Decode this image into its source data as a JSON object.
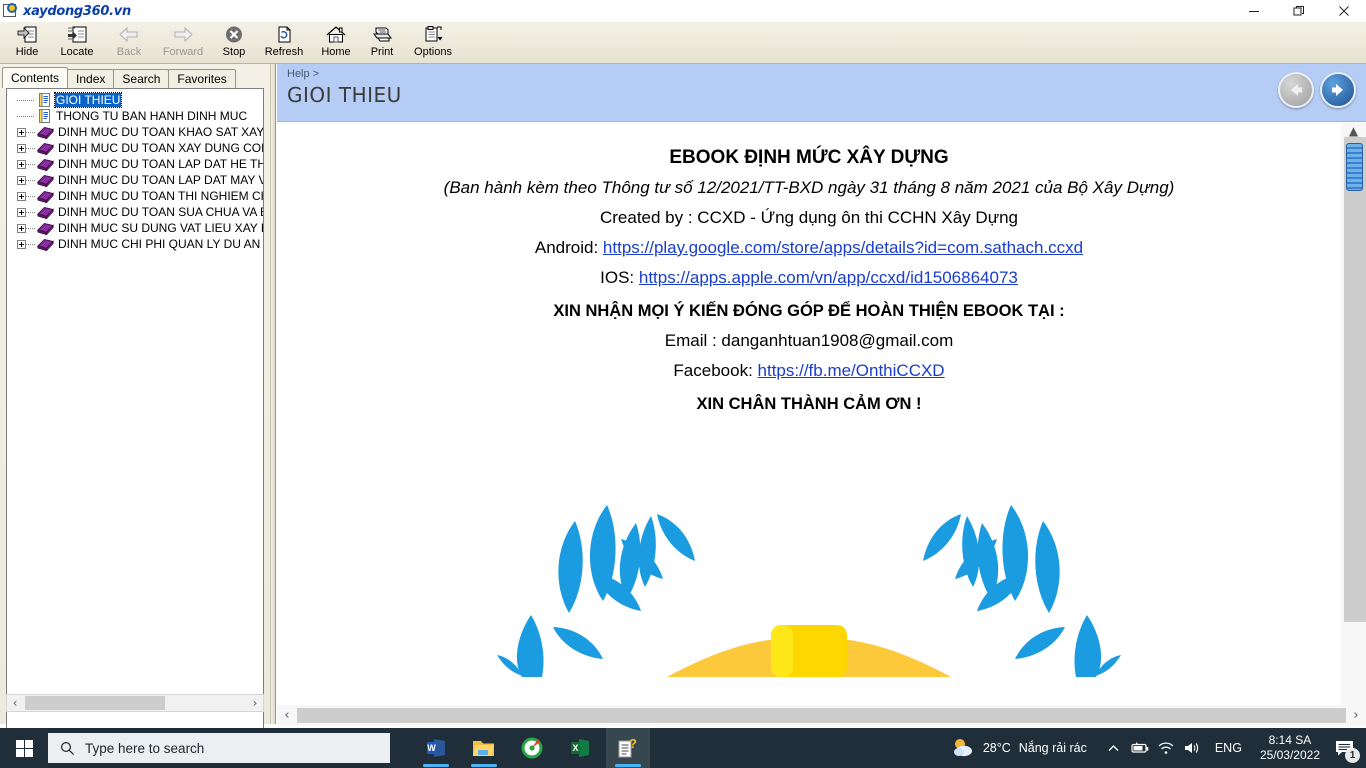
{
  "window": {
    "title": "xaydong360.vn",
    "app_icon": "help-viewer-icon",
    "minimize_label": "Minimize",
    "maximize_label": "Restore",
    "close_label": "Close"
  },
  "toolbar": {
    "buttons": [
      {
        "label": "Hide",
        "icon": "hide-panel-icon",
        "disabled": false
      },
      {
        "label": "Locate",
        "icon": "locate-icon",
        "disabled": false
      },
      {
        "label": "Back",
        "icon": "arrow-left-icon",
        "disabled": true
      },
      {
        "label": "Forward",
        "icon": "arrow-right-icon",
        "disabled": true
      },
      {
        "label": "Stop",
        "icon": "stop-icon",
        "disabled": false
      },
      {
        "label": "Refresh",
        "icon": "refresh-icon",
        "disabled": false
      },
      {
        "label": "Home",
        "icon": "home-icon",
        "disabled": false
      },
      {
        "label": "Print",
        "icon": "printer-icon",
        "disabled": false
      },
      {
        "label": "Options",
        "icon": "options-icon",
        "disabled": false
      }
    ]
  },
  "sidebar": {
    "tabs": [
      {
        "label": "Contents",
        "active": true
      },
      {
        "label": "Index",
        "active": false
      },
      {
        "label": "Search",
        "active": false
      },
      {
        "label": "Favorites",
        "active": false
      }
    ],
    "tree": [
      {
        "label": "GIOI THIEU",
        "icon": "page-icon",
        "expandable": false,
        "selected": true
      },
      {
        "label": "THONG TU BAN HANH DINH MUC",
        "icon": "page-icon",
        "expandable": false,
        "selected": false
      },
      {
        "label": "DINH MUC DU TOAN KHAO SAT XAY DUNG",
        "icon": "book-icon",
        "expandable": true,
        "selected": false
      },
      {
        "label": "DINH MUC DU TOAN XAY DUNG CONG TRINH",
        "icon": "book-icon",
        "expandable": true,
        "selected": false
      },
      {
        "label": "DINH MUC DU TOAN LAP DAT HE THONG KY THUAT",
        "icon": "book-icon",
        "expandable": true,
        "selected": false
      },
      {
        "label": "DINH MUC DU TOAN LAP DAT MAY VA THIET BI",
        "icon": "book-icon",
        "expandable": true,
        "selected": false
      },
      {
        "label": "DINH MUC DU TOAN THI NGHIEM CHUYEN NGANH",
        "icon": "book-icon",
        "expandable": true,
        "selected": false
      },
      {
        "label": "DINH MUC DU TOAN SUA CHUA VA BAO DUONG",
        "icon": "book-icon",
        "expandable": true,
        "selected": false
      },
      {
        "label": "DINH MUC SU DUNG VAT LIEU XAY DUNG",
        "icon": "book-icon",
        "expandable": true,
        "selected": false
      },
      {
        "label": "DINH MUC CHI PHI QUAN LY DU AN VA TU VAN",
        "icon": "book-icon",
        "expandable": true,
        "selected": false
      }
    ],
    "hscroll_left": "‹",
    "hscroll_right": "›"
  },
  "topic": {
    "breadcrumb": "Help >",
    "title": "GIOI THIEU",
    "nav_back": "back-arrow-button",
    "nav_forward": "forward-arrow-button",
    "header_color": "#b5ccf5"
  },
  "content": {
    "lines": [
      {
        "text": "EBOOK ĐỊNH MỨC XÂY DỰNG",
        "style": "bold"
      },
      {
        "text": "(Ban hành kèm theo Thông tư số 12/2021/TT-BXD ngày 31 tháng 8 năm 2021 của Bộ Xây Dựng)",
        "style": "italic"
      },
      {
        "text": "Created by : CCXD - Ứng dụng ôn thi CCHN Xây Dựng",
        "style": "normal"
      },
      {
        "text": "Android: ",
        "style": "normal",
        "link": "https://play.google.com/store/apps/details?id=com.sathach.ccxd"
      },
      {
        "text": "IOS: ",
        "style": "normal",
        "link": "https://apps.apple.com/vn/app/ccxd/id1506864073"
      },
      {
        "text": "XIN NHẬN MỌI Ý KIẾN ĐÓNG GÓP ĐỂ HOÀN THIỆN EBOOK TẠI :",
        "style": "bold-small"
      },
      {
        "text": "Email : danganhtuan1908@gmail.com",
        "style": "normal"
      },
      {
        "text": "Facebook: ",
        "style": "normal",
        "link": "https://fb.me/OnthiCCXD"
      },
      {
        "text": "XIN CHÂN THÀNH CẢM ƠN !",
        "style": "bold-small"
      }
    ],
    "graphic": {
      "name": "laurel-wreath-trophy",
      "leaf_color": "#1b9ce0",
      "trophy_color": "#ffd700",
      "trophy_shade": "#fcc93a"
    }
  },
  "taskbar": {
    "start_label": "Start",
    "search_placeholder": "Type here to search",
    "apps": [
      {
        "name": "word-taskbar-icon",
        "label": "W",
        "active": false,
        "running": true
      },
      {
        "name": "file-explorer-taskbar-icon",
        "label": "",
        "active": false,
        "running": true
      },
      {
        "name": "disc-app-taskbar-icon",
        "label": "",
        "active": false,
        "running": false
      },
      {
        "name": "excel-taskbar-icon",
        "label": "X",
        "active": false,
        "running": false
      },
      {
        "name": "help-viewer-taskbar-icon",
        "label": "",
        "active": true,
        "running": true
      }
    ],
    "tray": {
      "temperature": "28°C",
      "weather_text": "Nắng rải rác",
      "chevron": "^",
      "language": "ENG",
      "time": "8:14 SA",
      "date": "25/03/2022",
      "notification_count": "1"
    }
  }
}
